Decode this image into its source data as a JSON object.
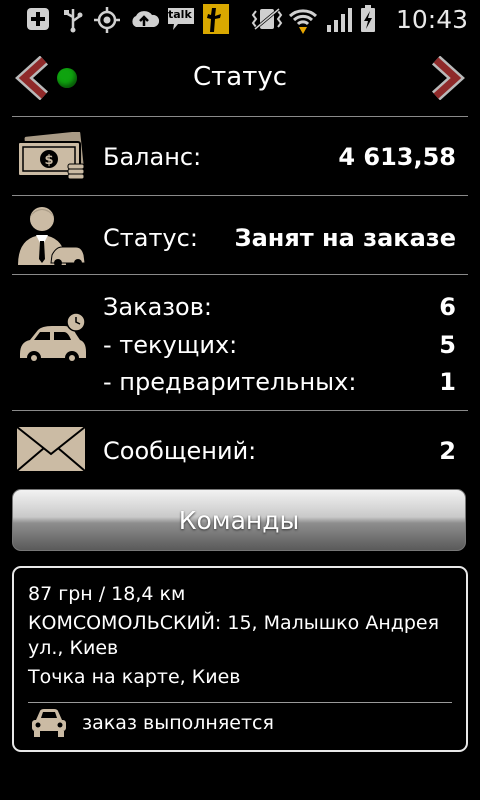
{
  "statusbar": {
    "time": "10:43",
    "icons": [
      "add-icon",
      "usb-icon",
      "gps-icon",
      "cloud-upload-icon",
      "talk-icon",
      "app-icon",
      "vibrate-icon",
      "wifi-icon",
      "signal-icon",
      "battery-charging-icon"
    ],
    "talk_label": "talk"
  },
  "header": {
    "title": "Статус",
    "online_color": "#0fa30f"
  },
  "balance": {
    "label": "Баланс:",
    "value": "4 613,58"
  },
  "status": {
    "label": "Статус:",
    "value": "Занят на заказе"
  },
  "orders": {
    "total_label": "Заказов:",
    "total_value": "6",
    "current_label": "- текущих:",
    "current_value": "5",
    "preliminary_label": "- предварительных:",
    "preliminary_value": "1"
  },
  "messages": {
    "label": "Сообщений:",
    "value": "2"
  },
  "commands_button": {
    "label": "Команды"
  },
  "order_card": {
    "price_distance": "87 грн / 18,4 км",
    "address_line1": "КОМСОМОЛЬСКИЙ: 15, Малышко Андрея",
    "address_line2": "ул., Киев",
    "destination": "Точка на карте, Киев",
    "state": "заказ выполняется"
  },
  "colors": {
    "icon_tan": "#cbbba4",
    "arrow_red": "#8f2a2a"
  }
}
